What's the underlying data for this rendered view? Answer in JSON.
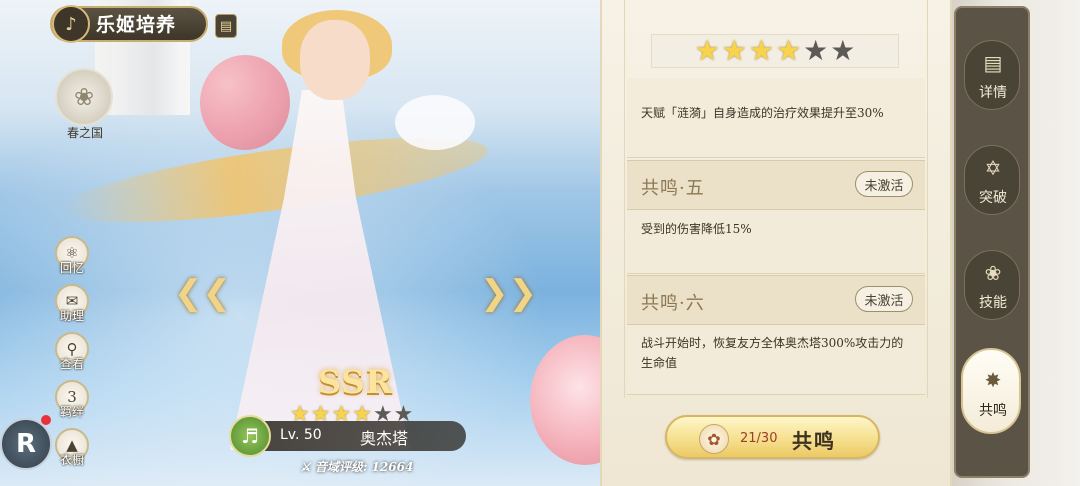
{
  "header": {
    "title": "乐姬培养",
    "emblem_icon": "music-note-emblem-icon",
    "memo_icon": "notebook-icon"
  },
  "nation": {
    "label": "春之国",
    "icon": "flower-crest-icon"
  },
  "side_menu": [
    {
      "label": "回忆",
      "icon": "memory-icon"
    },
    {
      "label": "助理",
      "icon": "assistant-icon"
    },
    {
      "label": "查看",
      "icon": "magnifier-icon"
    },
    {
      "label": "羁绊",
      "icon": "heart-badge-icon",
      "badge": "3"
    },
    {
      "label": "衣橱",
      "icon": "dress-icon"
    }
  ],
  "character": {
    "rarity": "SSR",
    "stars_filled": 4,
    "stars_total": 6,
    "level": "Lv. 50",
    "name": "奥杰塔",
    "rating": "音域评级: 12664",
    "class_icon": "lyre-icon",
    "colors": {
      "star_on": "#f7d44c",
      "star_off": "#5c5a55"
    }
  },
  "panel": {
    "rank_stars_filled": 4,
    "rank_stars_total": 6,
    "blocks": [
      {
        "title": "",
        "status": "",
        "description": "天赋「涟漪」自身造成的治疗效果提升至30%"
      },
      {
        "title": "共鸣·五",
        "status": "未激活",
        "description": "受到的伤害降低15%"
      },
      {
        "title": "共鸣·六",
        "status": "未激活",
        "description": "战斗开始时，恢复友方全体奥杰塔300%攻击力的生命值"
      }
    ],
    "resonance_button": {
      "count": "21/30",
      "label": "共鸣",
      "icon": "resonance-crystal-icon"
    }
  },
  "tabs": [
    {
      "label": "详情",
      "icon": "scroll-icon",
      "active": false
    },
    {
      "label": "突破",
      "icon": "star-of-david-icon",
      "active": false
    },
    {
      "label": "技能",
      "icon": "lotus-icon",
      "active": false
    },
    {
      "label": "共鸣",
      "icon": "sparkle-star-icon",
      "active": true
    }
  ],
  "r_logo": {
    "text": "R"
  }
}
